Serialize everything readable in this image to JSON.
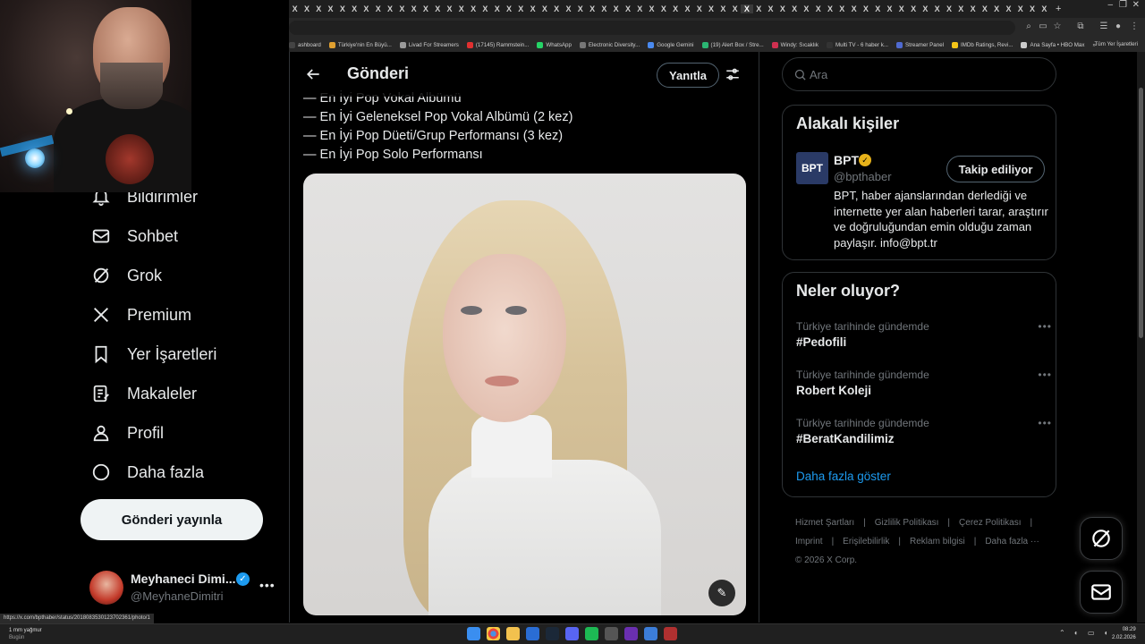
{
  "browser": {
    "tab_glyph": "X",
    "tab_count": 64,
    "new_tab": "+",
    "window_controls": [
      "–",
      "❐",
      "✕"
    ],
    "bookmarks": [
      {
        "label": "ashboard",
        "color": "#444444"
      },
      {
        "label": "Türkiye'nin En Büyü...",
        "color": "#e0a030"
      },
      {
        "label": "Livad For Streamers",
        "color": "#9a9a9a"
      },
      {
        "label": "(17145) Rammstein...",
        "color": "#e03030"
      },
      {
        "label": "WhatsApp",
        "color": "#25d366"
      },
      {
        "label": "Electronic Diversity...",
        "color": "#777777"
      },
      {
        "label": "Google Gemini",
        "color": "#4a8af0"
      },
      {
        "label": "(19) Alert Box / Stre...",
        "color": "#2bb673"
      },
      {
        "label": "Windy: Sıcaklık",
        "color": "#d03050"
      },
      {
        "label": "Multi TV - 6 haber k...",
        "color": "#333333"
      },
      {
        "label": "Streamer Panel",
        "color": "#4f6ad0"
      },
      {
        "label": "IMDb Ratings, Revi...",
        "color": "#f5c518"
      },
      {
        "label": "Ana Sayfa • HBO Max",
        "color": "#cccccc"
      }
    ],
    "bookmarks_more": "»",
    "bookmarks_folder": "Tüm Yer İşaretleri",
    "status_url": "https://x.com/bpthaber/status/2018083530123702361/photo/1"
  },
  "nav": {
    "items": [
      {
        "label": "Bildirimler",
        "icon": "bell-icon"
      },
      {
        "label": "Sohbet",
        "icon": "mail-icon"
      },
      {
        "label": "Grok",
        "icon": "grok-icon"
      },
      {
        "label": "Premium",
        "icon": "x-logo-icon"
      },
      {
        "label": "Yer İşaretleri",
        "icon": "bookmark-icon"
      },
      {
        "label": "Makaleler",
        "icon": "article-icon"
      },
      {
        "label": "Profil",
        "icon": "person-icon"
      },
      {
        "label": "Daha fazla",
        "icon": "more-circle-icon"
      }
    ],
    "post_button": "Gönderi yayınla",
    "account": {
      "name": "Meyhaneci Dimi...",
      "handle": "@MeyhaneDimitri",
      "more": "•••"
    }
  },
  "main": {
    "title": "Gönderi",
    "reply_button": "Yanıtla",
    "tweet_lines": [
      "— En İyi Pop Vokal Albümü",
      "— En İyi Geleneksel Pop Vokal Albümü (2 kez)",
      "— En İyi Pop Düeti/Grup Performansı (3 kez)",
      "— En İyi Pop Solo Performansı"
    ]
  },
  "sidebar": {
    "search_placeholder": "Ara",
    "related": {
      "title": "Alakalı kişiler",
      "logo": "BPT",
      "name": "BPT",
      "handle": "@bpthaber",
      "follow_button": "Takip ediliyor",
      "bio": "BPT, haber ajanslarından derlediği ve internette yer alan haberleri tarar, araştırır ve doğruluğundan emin olduğu zaman paylaşır. info@bpt.tr",
      "badge_color": "#e7b21a"
    },
    "trends": {
      "title": "Neler oluyor?",
      "items": [
        {
          "context": "Türkiye tarihinde gündemde",
          "name": "#Pedofili"
        },
        {
          "context": "Türkiye tarihinde gündemde",
          "name": "Robert Koleji"
        },
        {
          "context": "Türkiye tarihinde gündemde",
          "name": "#BeratKandilimiz"
        }
      ],
      "show_more": "Daha fazla göster"
    },
    "footer": {
      "links": [
        "Hizmet Şartları",
        "Gizlilik Politikası",
        "Çerez Politikası",
        "Imprint",
        "Erişilebilirlik",
        "Reklam bilgisi",
        "Daha fazla ···"
      ],
      "copyright": "© 2026 X Corp."
    }
  },
  "taskbar": {
    "weather": "1 mm yağmur",
    "weather_sub": "Bugün",
    "time": "08:29",
    "date": "2.02.2026"
  },
  "colors": {
    "accent": "#1d9bf0",
    "background": "#000000",
    "border": "#2f3336",
    "muted": "#71767b"
  }
}
